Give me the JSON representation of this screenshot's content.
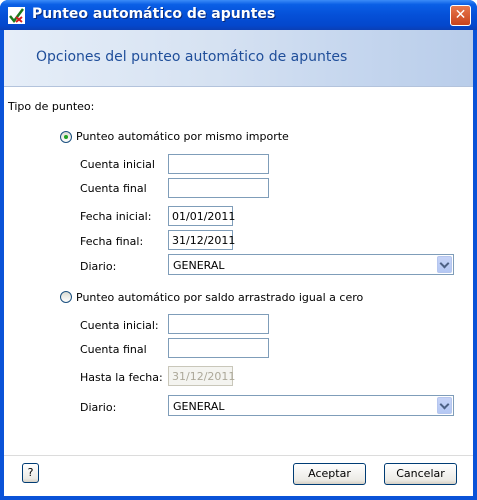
{
  "window": {
    "title": "Punteo automático de apuntes",
    "close_glyph": "✕"
  },
  "header": {
    "title": "Opciones del punteo automático de apuntes"
  },
  "form": {
    "tipo_label": "Tipo de punteo:",
    "option1": {
      "label": "Punteo automático por mismo importe",
      "selected": true,
      "cuenta_inicial_label": "Cuenta inicial",
      "cuenta_inicial_value": "",
      "cuenta_final_label": "Cuenta final",
      "cuenta_final_value": "",
      "fecha_inicial_label": "Fecha inicial:",
      "fecha_inicial_value": "01/01/2011",
      "fecha_final_label": "Fecha final:",
      "fecha_final_value": "31/12/2011",
      "diario_label": "Diario:",
      "diario_value": "GENERAL"
    },
    "option2": {
      "label": "Punteo automático por saldo arrastrado igual a cero",
      "selected": false,
      "cuenta_inicial_label": "Cuenta inicial:",
      "cuenta_inicial_value": "",
      "cuenta_final_label": "Cuenta final",
      "cuenta_final_value": "",
      "hasta_label": "Hasta la fecha:",
      "hasta_value": "31/12/2011",
      "diario_label": "Diario:",
      "diario_value": "GENERAL"
    }
  },
  "footer": {
    "help_label": "?",
    "accept_label": "Aceptar",
    "cancel_label": "Cancelar"
  }
}
